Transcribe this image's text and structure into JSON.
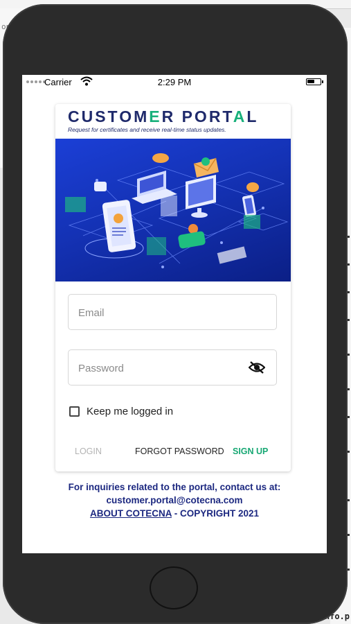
{
  "background": {
    "left_fragment": "on",
    "right_fragment": "nfo.p"
  },
  "status_bar": {
    "carrier": "Carrier",
    "time": "2:29 PM",
    "battery_level": 0.6
  },
  "header": {
    "title_part1": "CUSTOM",
    "title_accent1": "E",
    "title_part2": "R PORT",
    "title_accent2": "A",
    "title_part3": "L",
    "tagline": "Request for certificates and receive real-time status updates."
  },
  "form": {
    "email_placeholder": "Email",
    "password_placeholder": "Password",
    "remember_label": "Keep me logged in",
    "remember_checked": false
  },
  "actions": {
    "login": "LOGIN",
    "forgot_password": "FORGOT PASSWORD",
    "sign_up": "SIGN UP"
  },
  "footer": {
    "line1": "For inquiries related to the portal, contact us at:",
    "email": "customer.portal@cotecna.com",
    "about_link": "ABOUT COTECNA",
    "copyright": " - COPYRIGHT 2021"
  },
  "colors": {
    "brand_navy": "#1f2a6b",
    "brand_green": "#18b07b",
    "footer_blue": "#1c2880",
    "hero_blue": "#1b3fd6"
  }
}
